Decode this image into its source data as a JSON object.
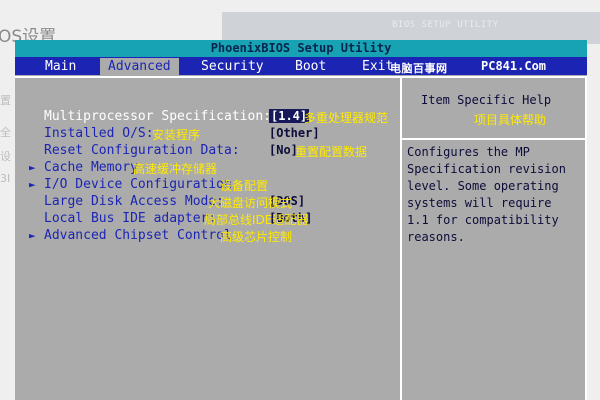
{
  "background": {
    "heading": "OS设置",
    "side_glyphs": [
      "置",
      "全",
      "设",
      "3I"
    ],
    "strip_text": "BIOS SETUP UTILITY"
  },
  "bios": {
    "title": "PhoenixBIOS Setup Utility",
    "tabs": [
      {
        "label": "Main",
        "active": false
      },
      {
        "label": "Advanced",
        "active": true
      },
      {
        "label": "Security",
        "active": false
      },
      {
        "label": "Boot",
        "active": false
      },
      {
        "label": "Exit",
        "active": false
      }
    ],
    "brand_cn": "电脑百事网",
    "brand_en": "PC841.Com",
    "items": [
      {
        "arrow": "",
        "label": "Multiprocessor Specification:",
        "value": "[1.4]",
        "annotation": "多重处理器规范",
        "selected": true
      },
      {
        "arrow": "",
        "label": "Installed O/S:",
        "value": "[Other]",
        "annotation": "安装程序",
        "selected": false
      },
      {
        "arrow": "",
        "label": "Reset Configuration Data:",
        "value": "[No]",
        "annotation": "重置配置数据",
        "selected": false
      },
      {
        "arrow": "►",
        "label": "Cache Memory",
        "value": "",
        "annotation": "高速缓冲存储器",
        "selected": false
      },
      {
        "arrow": "►",
        "label": "I/O Device Configuration",
        "value": "",
        "annotation": "设备配置",
        "selected": false
      },
      {
        "arrow": "",
        "label": "Large Disk Access Mode:",
        "value": "[DOS]",
        "annotation": "大磁盘访问模式",
        "selected": false
      },
      {
        "arrow": "",
        "label": "Local Bus IDE adapter:",
        "value": "[Both]",
        "annotation": "局部总线IDE适配器",
        "selected": false
      },
      {
        "arrow": "►",
        "label": "Advanced Chipset Control",
        "value": "",
        "annotation": "高级芯片控制",
        "selected": false
      }
    ],
    "help": {
      "title": "Item Specific Help",
      "annotation": "项目具体帮助",
      "text": "Configures the MP\nSpecification revision\nlevel.  Some operating\nsystems will require\n1.1 for compatibility\nreasons."
    },
    "colors": {
      "menubar": "#1c25b3",
      "titlebar": "#17a3b3",
      "panel": "#ababab",
      "annotation": "#ffea00"
    }
  }
}
